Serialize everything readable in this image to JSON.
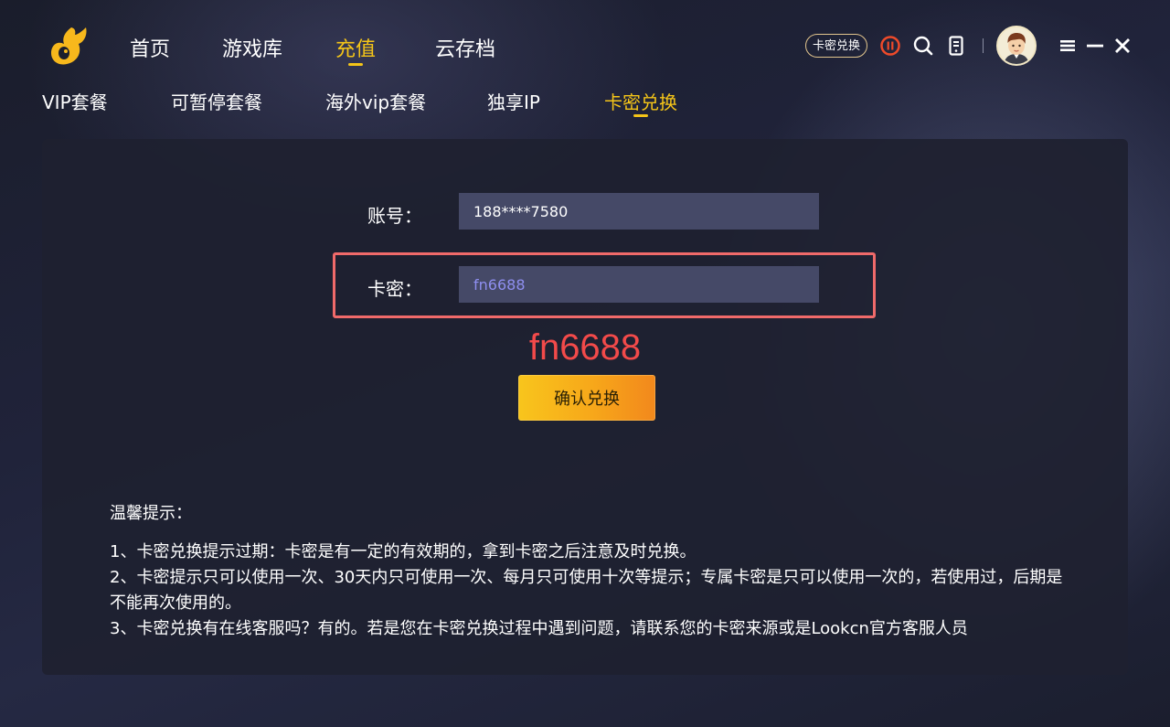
{
  "header": {
    "nav": [
      "首页",
      "游戏库",
      "充值",
      "云存档"
    ],
    "active_nav": "充值",
    "redeem_badge": "卡密兑换"
  },
  "sub_nav": {
    "items": [
      "VIP套餐",
      "可暂停套餐",
      "海外vip套餐",
      "独享IP",
      "卡密兑换"
    ],
    "active": "卡密兑换"
  },
  "form": {
    "account_label": "账号：",
    "account_value": "188****7580",
    "code_label": "卡密：",
    "code_value": "fn6688",
    "annotation": "fn6688",
    "confirm_label": "确认兑换"
  },
  "tips": {
    "title": "温馨提示：",
    "items": [
      "1、卡密兑换提示过期：卡密是有一定的有效期的，拿到卡密之后注意及时兑换。",
      "2、卡密提示只可以使用一次、30天内只可使用一次、每月只可使用十次等提示；专属卡密是只可以使用一次的，若使用过，后期是不能再次使用的。",
      "3、卡密兑换有在线客服吗？有的。若是您在卡密兑换过程中遇到问题，请联系您的卡密来源或是Lookcn官方客服人员"
    ]
  },
  "colors": {
    "accent": "#f5c518",
    "highlight": "#f06a6a",
    "annotation": "#f24a4a",
    "input_bg": "#454967"
  },
  "icons": [
    "logo-icon",
    "pause-icon",
    "search-icon",
    "phone-icon",
    "avatar",
    "menu-icon",
    "minimize-icon",
    "close-icon"
  ]
}
